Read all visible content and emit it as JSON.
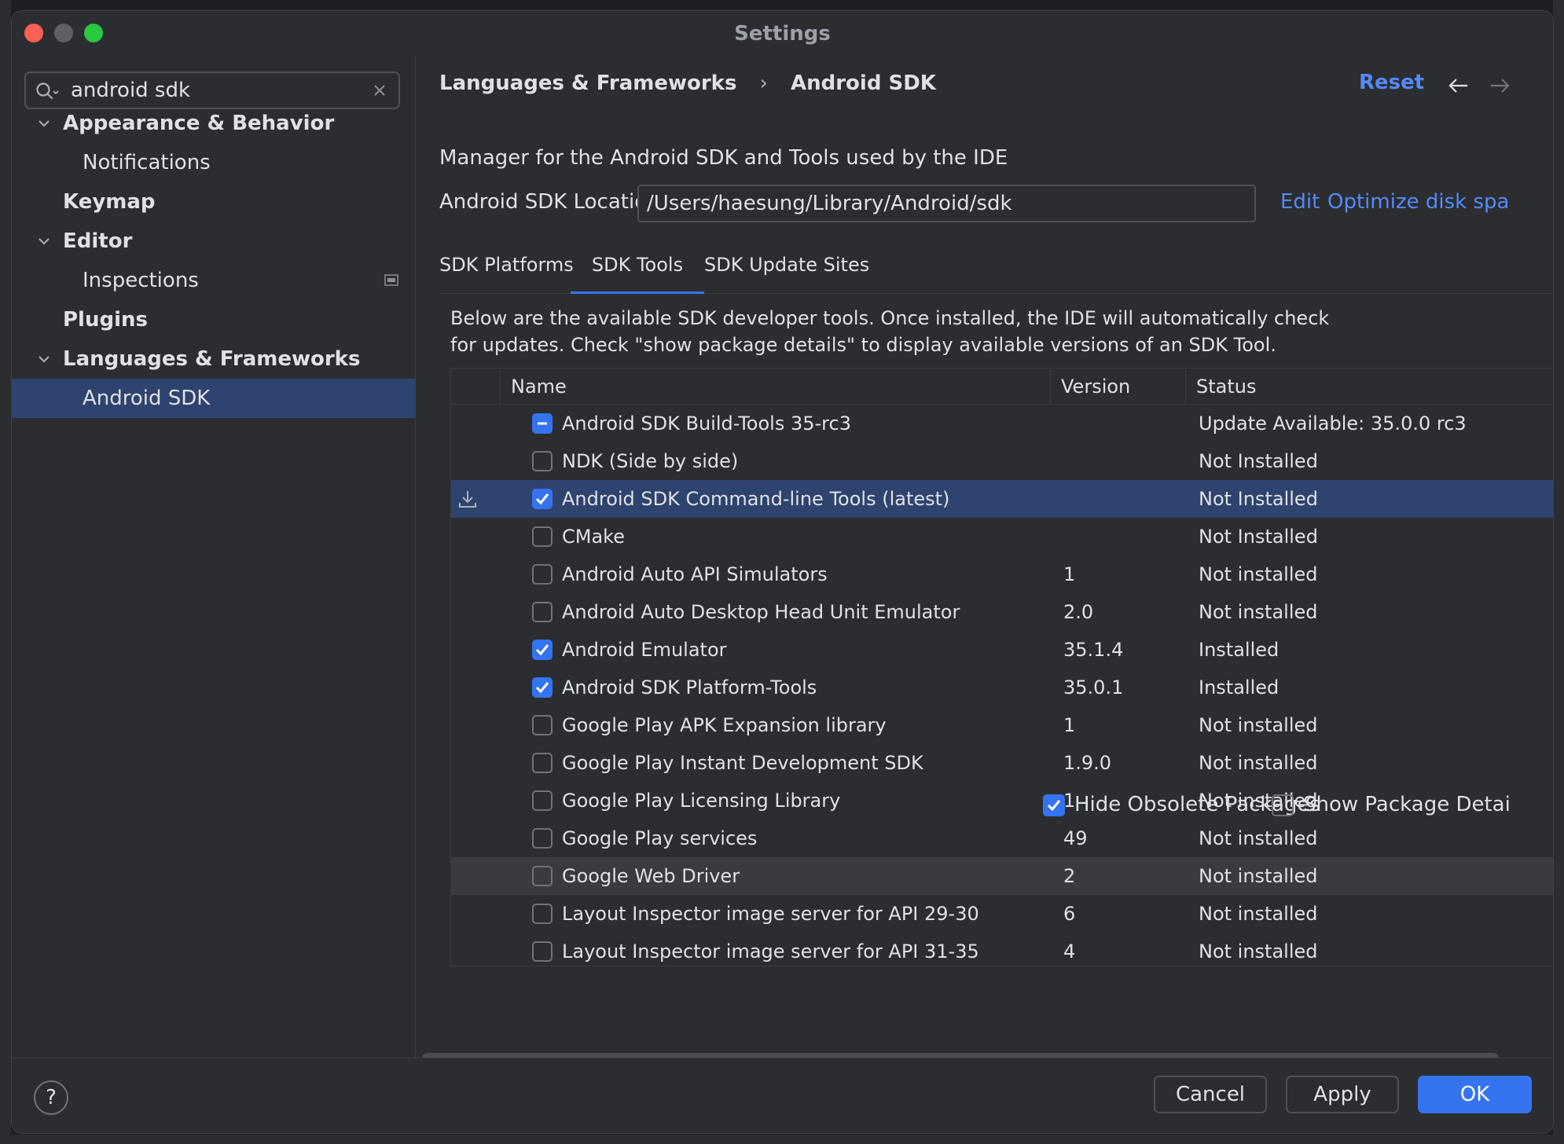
{
  "window": {
    "title": "Settings"
  },
  "search": {
    "value": "android sdk",
    "placeholder": ""
  },
  "sidebar": {
    "items": [
      {
        "label": "Appearance & Behavior"
      },
      {
        "label": "Notifications"
      },
      {
        "label": "Keymap"
      },
      {
        "label": "Editor"
      },
      {
        "label": "Inspections"
      },
      {
        "label": "Plugins"
      },
      {
        "label": "Languages & Frameworks"
      },
      {
        "label": "Android SDK"
      }
    ]
  },
  "header": {
    "breadcrumb": [
      "Languages & Frameworks",
      "Android SDK"
    ],
    "separator": "›",
    "reset_label": "Reset"
  },
  "main": {
    "description": "Manager for the Android SDK and Tools used by the IDE",
    "location_label": "Android SDK Location:",
    "location_value": "/Users/haesung/Library/Android/sdk",
    "edit_label": "Edit",
    "optimize_label": "Optimize disk spa",
    "tabs": [
      {
        "label": "SDK Platforms"
      },
      {
        "label": "SDK Tools"
      },
      {
        "label": "SDK Update Sites"
      }
    ],
    "active_tab": "SDK Tools",
    "tools_description": [
      "Below are the available SDK developer tools. Once installed, the IDE will automatically check",
      "for updates. Check \"show package details\" to display available versions of an SDK Tool."
    ]
  },
  "table": {
    "columns": [
      "Name",
      "Version",
      "Status"
    ],
    "rows": [
      {
        "name": "Android SDK Build-Tools 35-rc3",
        "version": "",
        "status": "Update Available: 35.0.0 rc3",
        "state": "partial"
      },
      {
        "name": "NDK (Side by side)",
        "version": "",
        "status": "Not Installed",
        "state": "unchecked"
      },
      {
        "name": "Android SDK Command-line Tools (latest)",
        "version": "",
        "status": "Not Installed",
        "state": "checked"
      },
      {
        "name": "CMake",
        "version": "",
        "status": "Not Installed",
        "state": "unchecked"
      },
      {
        "name": "Android Auto API Simulators",
        "version": "1",
        "status": "Not installed",
        "state": "unchecked"
      },
      {
        "name": "Android Auto Desktop Head Unit Emulator",
        "version": "2.0",
        "status": "Not installed",
        "state": "unchecked"
      },
      {
        "name": "Android Emulator",
        "version": "35.1.4",
        "status": "Installed",
        "state": "checked"
      },
      {
        "name": "Android SDK Platform-Tools",
        "version": "35.0.1",
        "status": "Installed",
        "state": "checked"
      },
      {
        "name": "Google Play APK Expansion library",
        "version": "1",
        "status": "Not installed",
        "state": "unchecked"
      },
      {
        "name": "Google Play Instant Development SDK",
        "version": "1.9.0",
        "status": "Not installed",
        "state": "unchecked"
      },
      {
        "name": "Google Play Licensing Library",
        "version": "1",
        "status": "Not installed",
        "state": "unchecked"
      },
      {
        "name": "Google Play services",
        "version": "49",
        "status": "Not installed",
        "state": "unchecked"
      },
      {
        "name": "Google Web Driver",
        "version": "2",
        "status": "Not installed",
        "state": "unchecked"
      },
      {
        "name": "Layout Inspector image server for API 29-30",
        "version": "6",
        "status": "Not installed",
        "state": "unchecked"
      },
      {
        "name": "Layout Inspector image server for API 31-35",
        "version": "4",
        "status": "Not installed",
        "state": "unchecked"
      }
    ],
    "selected_row": 2,
    "hovered_row": 12
  },
  "options": {
    "hide_obsolete_label": "Hide Obsolete Packages",
    "hide_obsolete_checked": true,
    "show_details_label": "Show Package Detai",
    "show_details_checked": false
  },
  "footer": {
    "help_label": "?",
    "cancel_label": "Cancel",
    "apply_label": "Apply",
    "ok_label": "OK"
  },
  "colors": {
    "accent": "#3574f0",
    "link": "#548af7",
    "selection": "#2e436e",
    "background": "#2b2d30"
  },
  "icons": {
    "search": "search-icon",
    "clear": "close-icon",
    "chevron": "chevron-down-icon",
    "back": "arrow-left-icon",
    "forward": "arrow-right-icon",
    "download": "download-icon",
    "checkmark": "checkmark-icon"
  }
}
